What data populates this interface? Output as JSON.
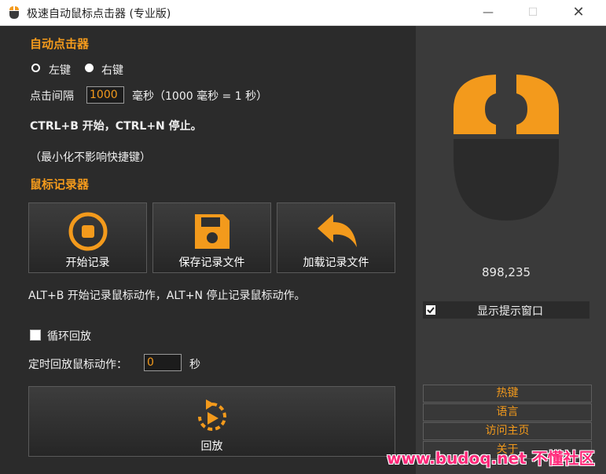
{
  "window": {
    "title": "极速自动鼠标点击器 (专业版)",
    "controls": {
      "minimize": "—",
      "maximize": "☐",
      "close": "✕"
    }
  },
  "auto_clicker": {
    "section_title": "自动点击器",
    "left_button_label": "左键",
    "right_button_label": "右键",
    "selected_button": "right",
    "interval_label": "点击间隔",
    "interval_value": "1000",
    "interval_unit": "毫秒（1000 毫秒 = 1 秒）",
    "hotkey_hint": "CTRL+B 开始，CTRL+N 停止。",
    "minimize_hint": "（最小化不影响快捷键）"
  },
  "recorder": {
    "section_title": "鼠标记录器",
    "start_record_label": "开始记录",
    "save_record_label": "保存记录文件",
    "load_record_label": "加载记录文件",
    "hotkey_hint": "ALT+B 开始记录鼠标动作，ALT+N 停止记录鼠标动作。",
    "loop_label": "循环回放",
    "loop_checked": false,
    "timed_label": "定时回放鼠标动作：",
    "timed_value": "0",
    "timed_unit": "秒",
    "replay_label": "回放"
  },
  "sidebar": {
    "click_count": "898,235",
    "show_tip_label": "显示提示窗口",
    "show_tip_checked": true,
    "links": [
      "热键",
      "语言",
      "访问主页",
      "关于"
    ]
  },
  "watermark": "www.budoq.net 不懂社区",
  "colors": {
    "accent": "#f39a1c",
    "background": "#2b2b2b",
    "panel": "#3a3a3a"
  }
}
